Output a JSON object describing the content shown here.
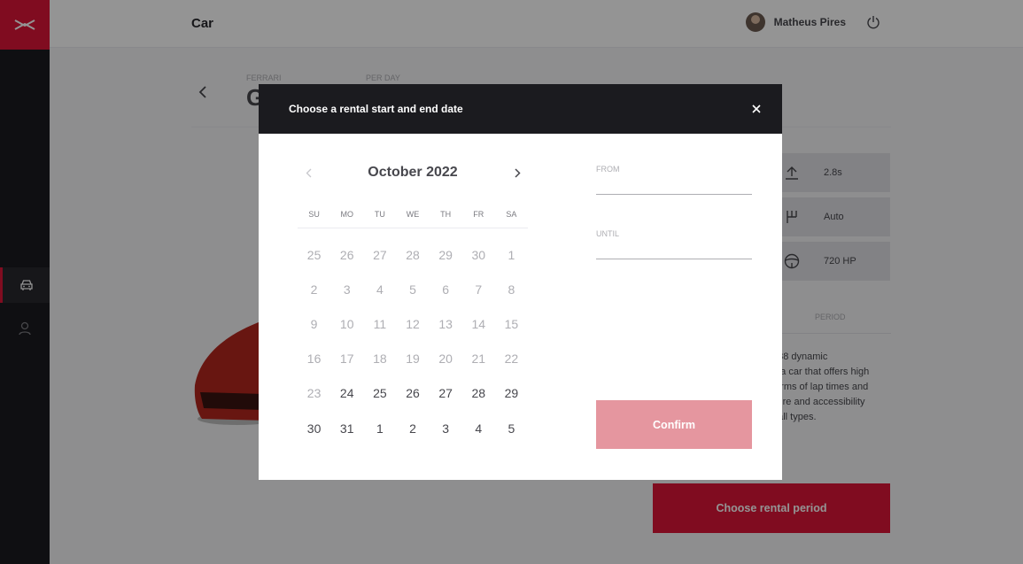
{
  "colors": {
    "brand": "#dc1637",
    "sidebar": "#1b1b1f",
    "confirm_disabled": "#e5969f",
    "text": "#47474d",
    "muted": "#aeaeb3"
  },
  "sidebar": {
    "logo_icon": "rentx-logo-icon",
    "items": [
      {
        "icon": "car-icon",
        "active": true
      },
      {
        "icon": "user-icon",
        "active": false
      }
    ]
  },
  "header": {
    "title": "Car",
    "user_name": "Matheus Pires",
    "logout_icon": "power-icon"
  },
  "car": {
    "brand_label": "FERRARI",
    "price_label": "PER DAY",
    "model_name_visible": "G",
    "specs": [
      {
        "icon": "acceleration-icon",
        "value": "2.8s"
      },
      {
        "icon": "gear-shift-icon",
        "value": "Auto"
      },
      {
        "icon": "steering-wheel-icon",
        "value": "720 HP"
      }
    ],
    "period_tab": "PERIOD",
    "description_lines": [
      "488 dynamic",
      "e a car that offers high",
      "terms of lap times and",
      "sure and accessibility",
      "f all types."
    ],
    "cta_label": "Choose rental period"
  },
  "modal": {
    "title": "Choose a rental start and end date",
    "calendar": {
      "month": "October 2022",
      "weekdays": [
        "SU",
        "MO",
        "TU",
        "WE",
        "TH",
        "FR",
        "SA"
      ],
      "weeks": [
        [
          {
            "d": "25",
            "m": true
          },
          {
            "d": "26",
            "m": true
          },
          {
            "d": "27",
            "m": true
          },
          {
            "d": "28",
            "m": true
          },
          {
            "d": "29",
            "m": true
          },
          {
            "d": "30",
            "m": true
          },
          {
            "d": "1",
            "m": true
          }
        ],
        [
          {
            "d": "2",
            "m": true
          },
          {
            "d": "3",
            "m": true
          },
          {
            "d": "4",
            "m": true
          },
          {
            "d": "5",
            "m": true
          },
          {
            "d": "6",
            "m": true
          },
          {
            "d": "7",
            "m": true
          },
          {
            "d": "8",
            "m": true
          }
        ],
        [
          {
            "d": "9",
            "m": true
          },
          {
            "d": "10",
            "m": true
          },
          {
            "d": "11",
            "m": true
          },
          {
            "d": "12",
            "m": true
          },
          {
            "d": "13",
            "m": true
          },
          {
            "d": "14",
            "m": true
          },
          {
            "d": "15",
            "m": true
          }
        ],
        [
          {
            "d": "16",
            "m": true
          },
          {
            "d": "17",
            "m": true
          },
          {
            "d": "18",
            "m": true
          },
          {
            "d": "19",
            "m": true
          },
          {
            "d": "20",
            "m": true
          },
          {
            "d": "21",
            "m": true
          },
          {
            "d": "22",
            "m": true
          }
        ],
        [
          {
            "d": "23",
            "m": true
          },
          {
            "d": "24",
            "m": false
          },
          {
            "d": "25",
            "m": false
          },
          {
            "d": "26",
            "m": false
          },
          {
            "d": "27",
            "m": false
          },
          {
            "d": "28",
            "m": false
          },
          {
            "d": "29",
            "m": false
          }
        ],
        [
          {
            "d": "30",
            "m": false
          },
          {
            "d": "31",
            "m": false
          },
          {
            "d": "1",
            "m": false
          },
          {
            "d": "2",
            "m": false
          },
          {
            "d": "3",
            "m": false
          },
          {
            "d": "4",
            "m": false
          },
          {
            "d": "5",
            "m": false
          }
        ]
      ]
    },
    "from_label": "FROM",
    "from_value": "",
    "until_label": "UNTIL",
    "until_value": "",
    "confirm_label": "Confirm"
  }
}
